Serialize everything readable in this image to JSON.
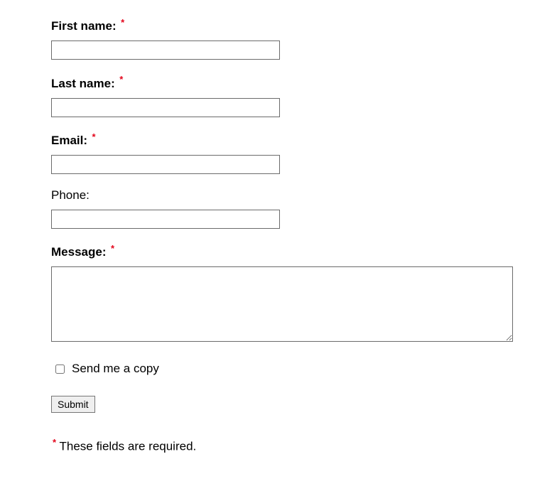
{
  "fields": {
    "first_name": {
      "label": "First name:",
      "value": ""
    },
    "last_name": {
      "label": "Last name:",
      "value": ""
    },
    "email": {
      "label": "Email:",
      "value": ""
    },
    "phone": {
      "label": "Phone:",
      "value": ""
    },
    "message": {
      "label": "Message:",
      "value": ""
    }
  },
  "required_marker": "*",
  "checkbox": {
    "label": "Send me a copy",
    "checked": false
  },
  "submit_label": "Submit",
  "footnote_text": " These fields are required."
}
